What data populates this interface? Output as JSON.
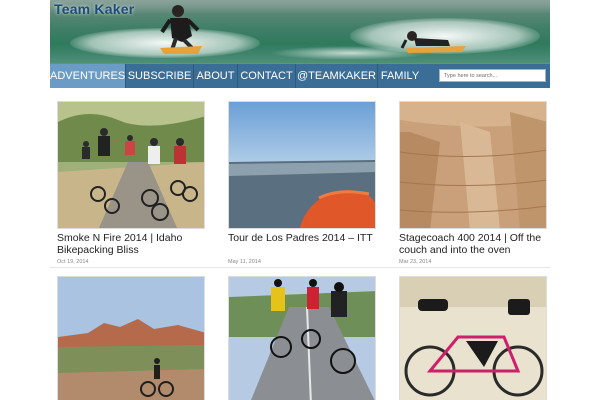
{
  "header": {
    "site_title": "Team Kaker"
  },
  "nav": {
    "items": [
      {
        "label": "ADVENTURES",
        "active": true
      },
      {
        "label": "SUBSCRIBE",
        "active": false
      },
      {
        "label": "ABOUT",
        "active": false
      },
      {
        "label": "CONTACT",
        "active": false
      },
      {
        "label": "@TEAMKAKER",
        "active": false
      },
      {
        "label": "FAMILY",
        "active": false
      }
    ],
    "search_placeholder": "Type here to search..."
  },
  "posts": [
    {
      "title": "Smoke N Fire 2014 | Idaho Bikepacking Bliss",
      "date": "Oct 19, 2014",
      "image": "group of mountain bikers on dirt road"
    },
    {
      "title": "Tour de Los Padres 2014 – ITT",
      "date": "May 11, 2014",
      "image": "sunset over valley with orange helmet"
    },
    {
      "title": "Stagecoach 400 2014 | Off the couch and into the oven",
      "date": "Mar 23, 2014",
      "image": "sandstone rock wall"
    },
    {
      "title": "",
      "date": "",
      "image": "cyclist below red desert mesa"
    },
    {
      "title": "",
      "date": "",
      "image": "road cyclists on highway"
    },
    {
      "title": "",
      "date": "",
      "image": "loaded bikepacking bike indoors"
    }
  ],
  "colors": {
    "nav_bg": "#3b6e96",
    "nav_active": "#6b9cc6",
    "title_blue": "#1d4b7a"
  }
}
